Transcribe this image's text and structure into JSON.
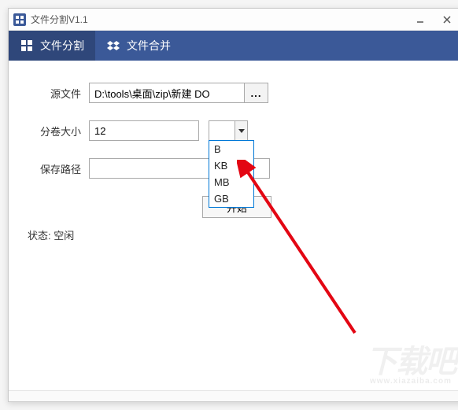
{
  "titlebar": {
    "app_icon_glyph": "✥",
    "title": "文件分割V1.1"
  },
  "tabs": {
    "split": "文件分割",
    "merge": "文件合并"
  },
  "form": {
    "source_label": "源文件",
    "source_value": "D:\\tools\\桌面\\zip\\新建 DO",
    "browse_label": "...",
    "size_label": "分卷大小",
    "size_value": "12",
    "unit_value": "",
    "unit_options": [
      "B",
      "KB",
      "MB",
      "GB"
    ],
    "savepath_label": "保存路径",
    "savepath_value": "",
    "start_label": "开始"
  },
  "status": {
    "prefix": "状态: ",
    "value": "空闲"
  },
  "watermark": {
    "main": "下载吧",
    "sub": "www.xiazaiba.com"
  }
}
